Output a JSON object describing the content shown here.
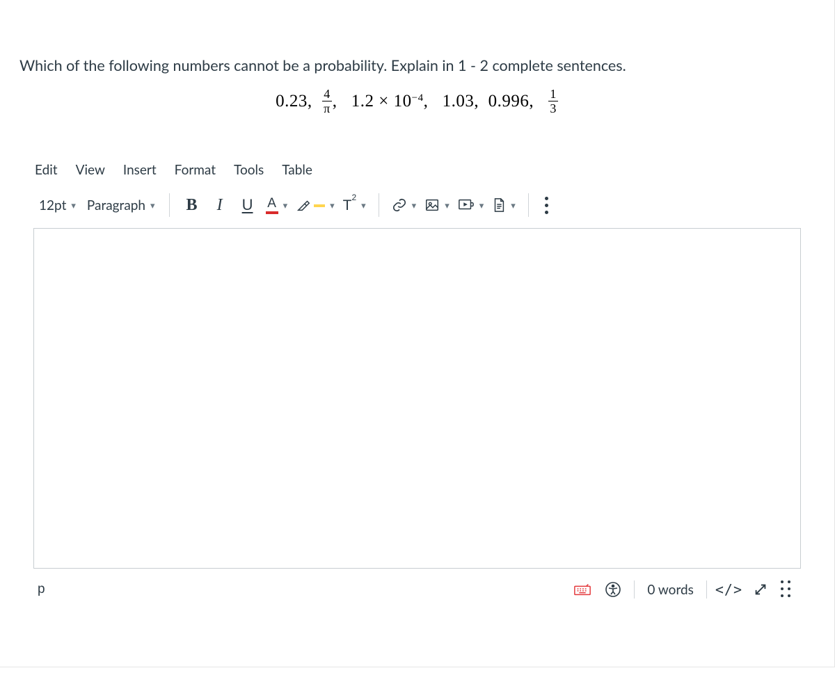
{
  "question": {
    "prompt": "Which of the following numbers cannot be a probability.  Explain in 1 - 2 complete sentences.",
    "values_display": "0.23,  4/π,  1.2 × 10⁻⁴,  1.03,  0.996,  1/3"
  },
  "menubar": {
    "edit": "Edit",
    "view": "View",
    "insert": "Insert",
    "format": "Format",
    "tools": "Tools",
    "table": "Table"
  },
  "toolbar": {
    "font_size": "12pt",
    "block_format": "Paragraph",
    "bold": "B",
    "italic": "I",
    "underline": "U",
    "text_color_letter": "A",
    "superscript_label": "T",
    "superscript_exp": "2"
  },
  "statusbar": {
    "path": "p",
    "word_count": "0 words",
    "html_label": "</>"
  }
}
